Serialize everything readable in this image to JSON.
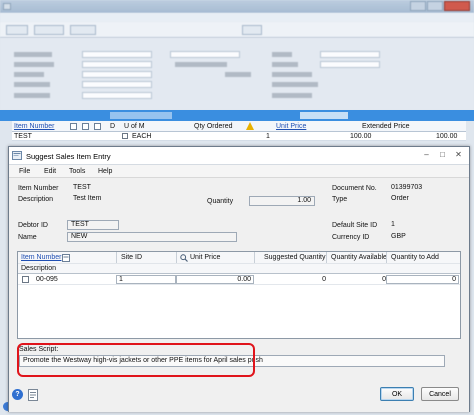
{
  "background_window": {
    "grid_headers": {
      "item_number": "Item Number",
      "d": "D",
      "u_of_m": "U of M",
      "qty_ordered": "Qty Ordered",
      "unit_price": "Unit Price",
      "extended_price": "Extended Price"
    },
    "grid_row": {
      "item_number": "TEST",
      "u_of_m": "EACH",
      "qty": "1",
      "unit_price": "100.00",
      "extended_price": "100.00"
    }
  },
  "dialog": {
    "title": "Suggest Sales Item Entry",
    "menu": [
      "File",
      "Edit",
      "Tools",
      "Help"
    ],
    "fields": {
      "item_number_label": "Item Number",
      "item_number_value": "TEST",
      "description_label": "Description",
      "description_value": "Test Item",
      "quantity_label": "Quantity",
      "quantity_value": "1.00",
      "document_no_label": "Document No.",
      "document_no_value": "01399703",
      "type_label": "Type",
      "type_value": "Order",
      "debtor_id_label": "Debtor ID",
      "debtor_id_value": "TEST",
      "name_label": "Name",
      "name_value": "NEW",
      "default_site_label": "Default Site ID",
      "default_site_value": "1",
      "currency_label": "Currency ID",
      "currency_value": "GBP"
    },
    "grid": {
      "headers": {
        "item_number": "Item Number",
        "site_id": "Site ID",
        "unit_price": "Unit Price",
        "suggested_qty": "Suggested Quantity",
        "qty_available": "Quantity Available",
        "qty_to_add": "Quantity to Add",
        "description": "Description"
      },
      "rows": [
        {
          "item_number": "00-095",
          "site_id": "1",
          "unit_price": "0.00",
          "suggested_qty": "0",
          "qty_available": "0",
          "qty_to_add": "0"
        }
      ]
    },
    "sales_script": {
      "label": "Sales Script:",
      "text": "Promote the Westway high-vis jackets or other PPE items for April sales push"
    },
    "buttons": {
      "ok": "OK",
      "cancel": "Cancel"
    }
  },
  "colors": {
    "highlight_red": "#e0141b",
    "link_blue": "#1f4fb3",
    "title_blue_bar": "#3a8ee0"
  }
}
